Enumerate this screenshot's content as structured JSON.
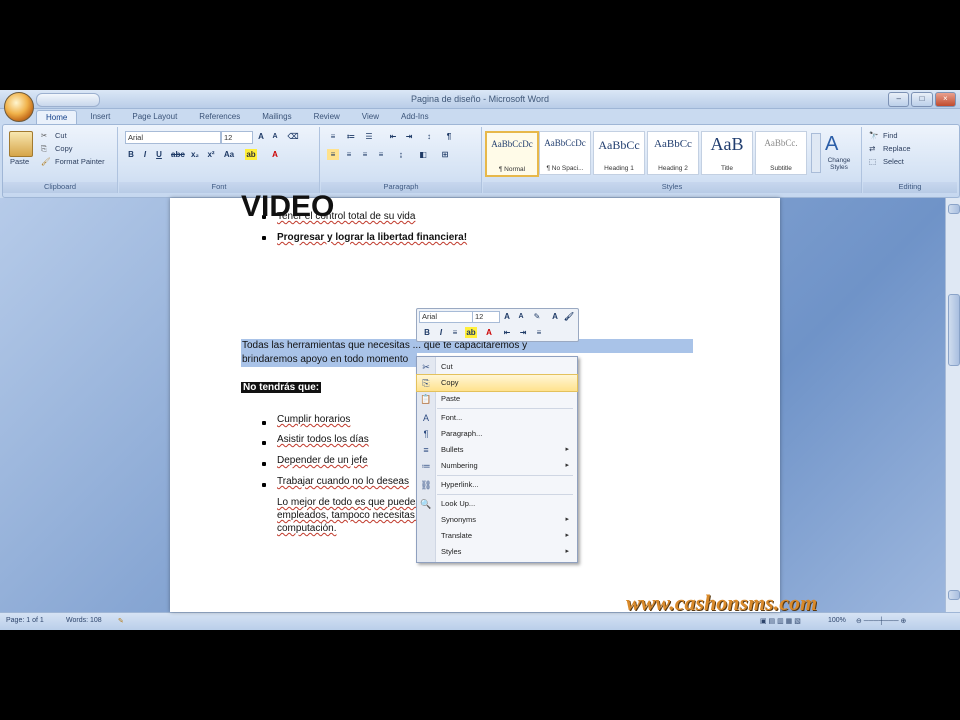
{
  "window": {
    "title": "Pagina de diseño - Microsoft Word"
  },
  "window_controls": {
    "minimize": "–",
    "maximize": "□",
    "close": "×"
  },
  "tabs": [
    "Home",
    "Insert",
    "Page Layout",
    "References",
    "Mailings",
    "Review",
    "View",
    "Add-Ins"
  ],
  "ribbon": {
    "clipboard": {
      "label": "Clipboard",
      "paste": "Paste",
      "cut": "Cut",
      "copy": "Copy",
      "format_painter": "Format Painter"
    },
    "font": {
      "label": "Font",
      "font_name": "Arial",
      "font_size": "12"
    },
    "paragraph": {
      "label": "Paragraph"
    },
    "styles": {
      "label": "Styles",
      "items": [
        {
          "sample": "AaBbCcDc",
          "name": "¶ Normal"
        },
        {
          "sample": "AaBbCcDc",
          "name": "¶ No Spaci..."
        },
        {
          "sample": "AaBbCc",
          "name": "Heading 1"
        },
        {
          "sample": "AaBbCc",
          "name": "Heading 2"
        },
        {
          "sample": "AaB",
          "name": "Title"
        },
        {
          "sample": "AaBbCc.",
          "name": "Subtitle"
        }
      ],
      "change_styles": "Change Styles"
    },
    "editing": {
      "label": "Editing",
      "find": "Find",
      "replace": "Replace",
      "select": "Select"
    }
  },
  "document": {
    "bullets_top": [
      {
        "text": "Tener el control total de su vida",
        "bold": false
      },
      {
        "text": "Progresar y lograr la libertad financiera!",
        "bold": true
      }
    ],
    "heading": "VIDEO",
    "selected_paragraph": [
      "Todas las herramientas que necesitas ... que te capacitaremos y",
      "brindaremos apoyo en todo momento"
    ],
    "highlighted_line": "No tendrás que:",
    "bullets": [
      "Cumplir horarios",
      "Asistir todos los días",
      "Depender de un jefe",
      "Trabajar cuando no lo deseas"
    ],
    "closing_paragraph": [
      "Lo mejor de todo es que puedes ... necesitas tener un local o",
      "empleados, tampoco necesitas ... ni ser un genio en",
      "computación."
    ]
  },
  "context_menu": {
    "items": [
      {
        "label": "Cut",
        "icon": "scissors-icon",
        "glyph": "✂"
      },
      {
        "label": "Copy",
        "icon": "copy-icon",
        "glyph": "⎘",
        "highlighted": true
      },
      {
        "label": "Paste",
        "icon": "paste-icon",
        "glyph": "📋"
      },
      {
        "label": "Font...",
        "icon": "font-icon",
        "glyph": "A"
      },
      {
        "label": "Paragraph...",
        "icon": "paragraph-icon",
        "glyph": "¶"
      },
      {
        "label": "Bullets",
        "icon": "bullets-icon",
        "glyph": "≡",
        "submenu": true
      },
      {
        "label": "Numbering",
        "icon": "numbering-icon",
        "glyph": "≔",
        "submenu": true
      },
      {
        "label": "Hyperlink...",
        "icon": "hyperlink-icon",
        "glyph": "⛓"
      },
      {
        "label": "Look Up...",
        "icon": "lookup-icon",
        "glyph": "🔍"
      },
      {
        "label": "Synonyms",
        "icon": "synonyms-icon",
        "glyph": "",
        "submenu": true
      },
      {
        "label": "Translate",
        "icon": "translate-icon",
        "glyph": "",
        "submenu": true
      },
      {
        "label": "Styles",
        "icon": "styles-icon",
        "glyph": "",
        "submenu": true
      }
    ]
  },
  "status": {
    "page": "Page: 1 of 1",
    "words": "Words: 108",
    "zoom": "100%"
  },
  "watermark": "www.cashonsms.com",
  "colors": {
    "ribbon": "#d4e2f4",
    "highlight": "#ffe28d",
    "selection": "#a9c3e8",
    "watermark": "#d98a2b"
  }
}
